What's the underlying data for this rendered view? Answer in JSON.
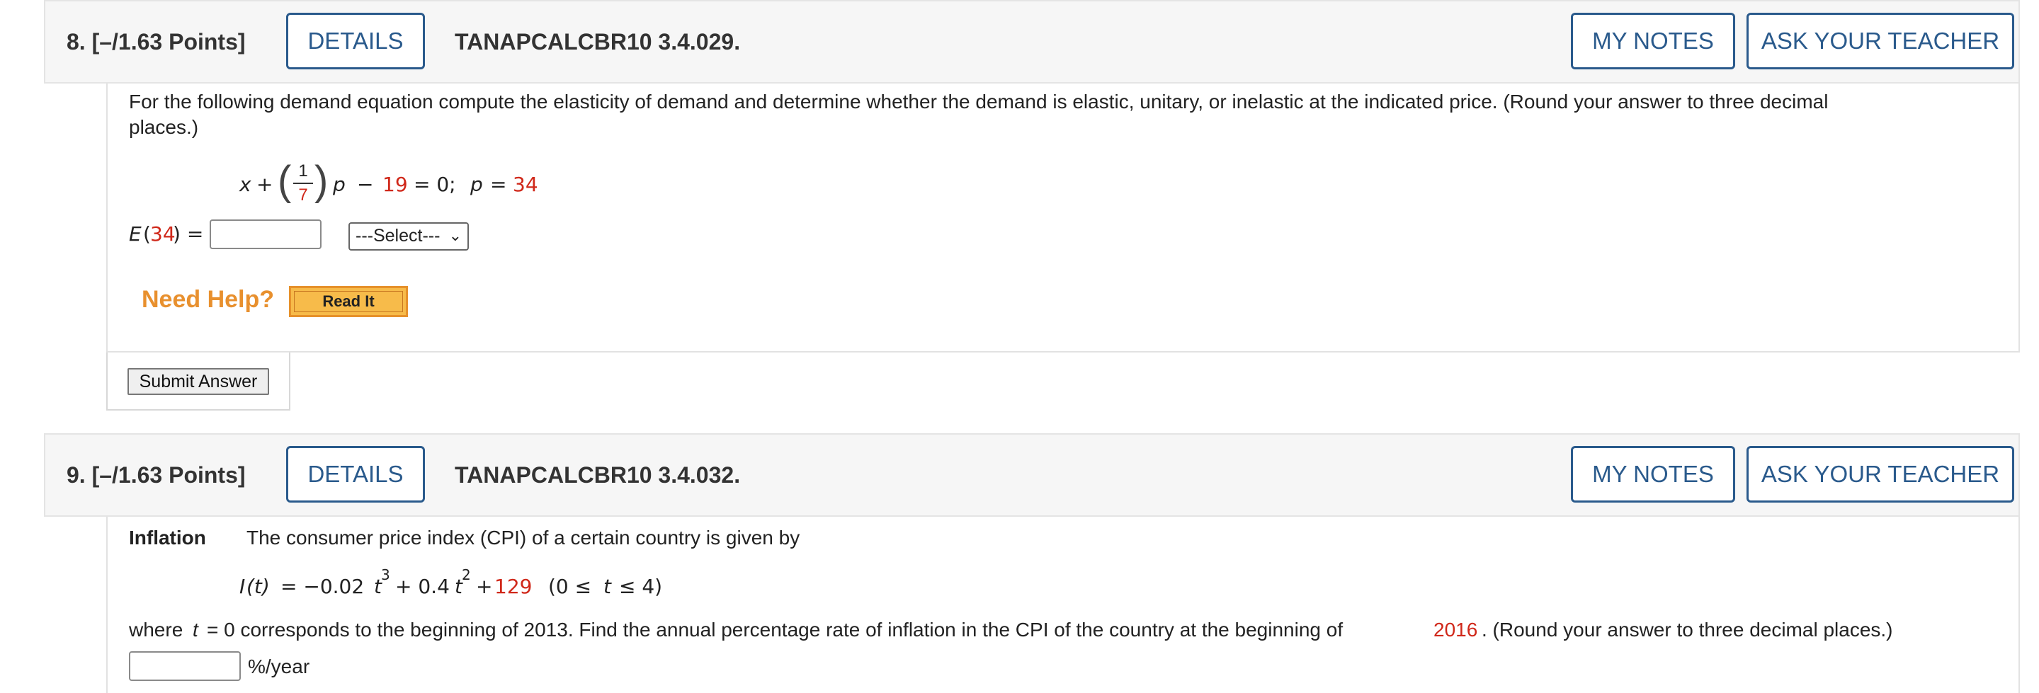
{
  "q8": {
    "number": "8.",
    "points": "[–/1.63 Points]",
    "details_label": "DETAILS",
    "code": "TANAPCALCBR10 3.4.029.",
    "my_notes_label": "MY NOTES",
    "ask_teacher_label": "ASK YOUR TEACHER",
    "prompt_line1": "For the following demand equation compute the elasticity of demand and determine whether the demand is elastic, unitary, or inelastic at the indicated price. (Round your answer to three decimal",
    "prompt_line2": "places.)",
    "eq_x": "x",
    "eq_plus": "+",
    "frac_num": "1",
    "frac_den": "7",
    "eq_p": "p",
    "eq_minus": "−",
    "eq_const": "19",
    "eq_zero": "= 0;",
    "eq_p2": "p",
    "eq_eq": "=",
    "eq_price": "34",
    "answer_label_E": "E",
    "answer_label_open": "(",
    "answer_label_arg": "34",
    "answer_label_close": ") =",
    "answer_value": "",
    "select_value": "---Select---",
    "need_help": "Need Help?",
    "read_it": "Read It",
    "submit": "Submit Answer"
  },
  "q9": {
    "number": "9.",
    "points": "[–/1.63 Points]",
    "details_label": "DETAILS",
    "code": "TANAPCALCBR10 3.4.032.",
    "my_notes_label": "MY NOTES",
    "ask_teacher_label": "ASK YOUR TEACHER",
    "topic": "Inflation",
    "intro": "The consumer price index (CPI) of a certain country is given by",
    "eq_lhs_I": "I",
    "eq_lhs_t": "(t)",
    "eq_part1": "= −0.02",
    "eq_t1": "t",
    "eq_exp1": "3",
    "eq_part2": "+ 0.4",
    "eq_t2": "t",
    "eq_exp2": "2",
    "eq_part3": "+",
    "eq_const": "129",
    "eq_domain_open": "(0 ≤",
    "eq_domain_t": "t",
    "eq_domain_close": "≤ 4)",
    "where_pre": "where",
    "where_t": "t",
    "where_mid": "= 0 corresponds to the beginning of 2013. Find the annual percentage rate of inflation in the CPI of the country at the beginning of",
    "where_year": "2016",
    "where_post": ". (Round your answer to three decimal places.)",
    "answer_value": "",
    "unit": "%/year"
  }
}
